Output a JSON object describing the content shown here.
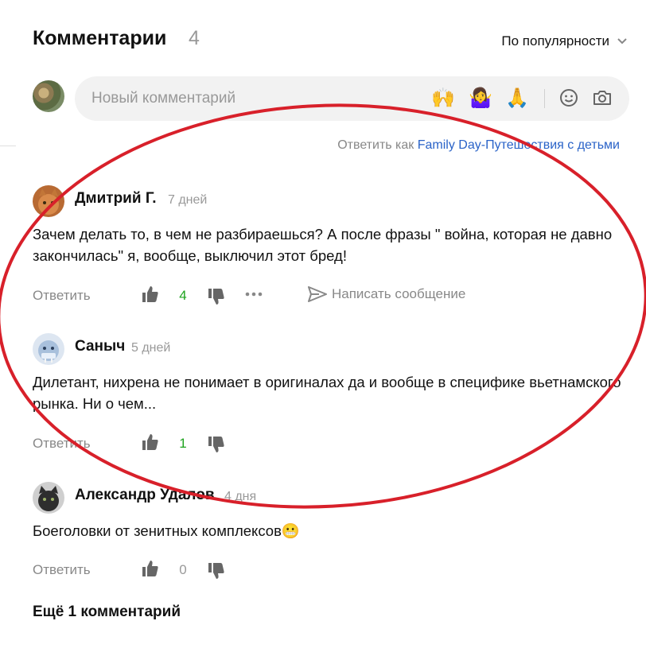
{
  "header": {
    "title": "Комментарии",
    "count": "4",
    "sort_label": "По популярности"
  },
  "new_comment": {
    "placeholder": "Новый комментарий",
    "emojis": [
      "🙌",
      "🤷‍♀️",
      "🙏"
    ]
  },
  "reply_as": {
    "prefix": "Ответить как ",
    "account": "Family Day-Путешествия с детьми"
  },
  "comments": [
    {
      "author": "Дмитрий Г.",
      "time": "7 дней",
      "text": "Зачем делать то, в чем не разбираешься? А после фразы \" война, которая не давно закончилась\" я, вообще, выключил этот бред!",
      "reply": "Ответить",
      "likes": "4",
      "message": "Написать сообщение"
    },
    {
      "author": "Саныч",
      "time": "5 дней",
      "text": "Дилетант, нихрена не понимает в оригиналах да и вообще в специфике вьетнамского рынка. Ни о чем...",
      "reply": "Ответить",
      "likes": "1"
    },
    {
      "author": "Александр Удалов",
      "time": "4 дня",
      "text": "Боеголовки от зенитных комплексов😬",
      "reply": "Ответить",
      "likes": "0"
    }
  ],
  "more_comments": "Ещё 1 комментарий",
  "colors": {
    "accent_link": "#2a63c8",
    "like_positive": "#1ea31e",
    "annotation_red": "#d8202a"
  }
}
